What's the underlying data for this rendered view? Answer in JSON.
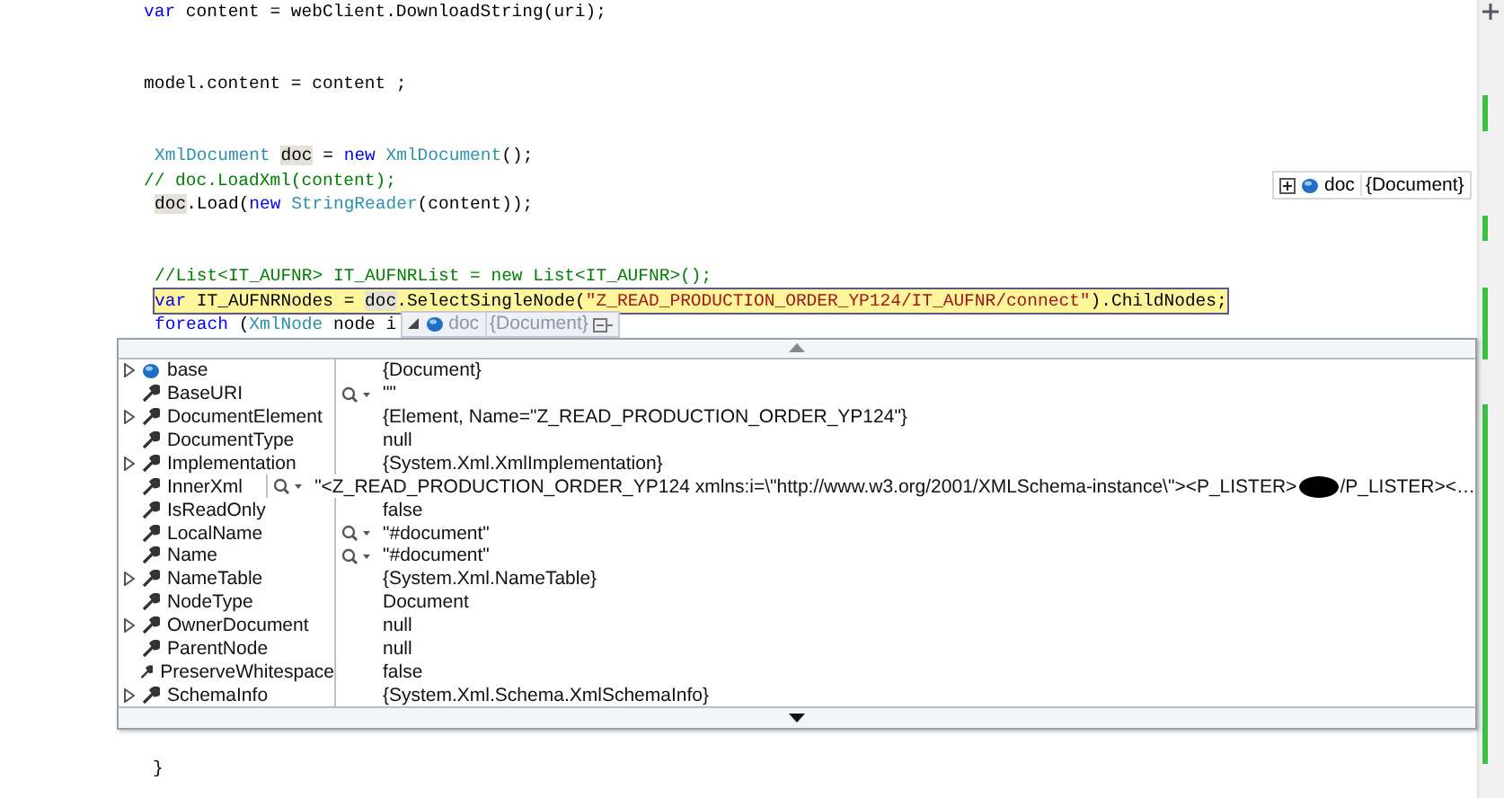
{
  "code_blocks": [
    {
      "lines": [
        {
          "kind": "flush",
          "current": false,
          "tokens": [
            {
              "kind": "keyword",
              "text": "var"
            },
            {
              "kind": "plain",
              "text": " content = webClient.DownloadString(uri);"
            }
          ]
        }
      ]
    },
    {
      "lines": [
        {
          "kind": "flush",
          "current": false,
          "tokens": [
            {
              "kind": "plain",
              "text": "model.content = content ;"
            }
          ]
        }
      ]
    },
    {
      "lines": [
        {
          "kind": "indented",
          "current": false,
          "tokens": [
            {
              "kind": "type",
              "text": "XmlDocument "
            },
            {
              "kind": "reference",
              "text": "doc"
            },
            {
              "kind": "plain",
              "text": " = "
            },
            {
              "kind": "keyword",
              "text": "new "
            },
            {
              "kind": "type",
              "text": "XmlDocument"
            },
            {
              "kind": "plain",
              "text": "();"
            }
          ]
        },
        {
          "kind": "flush",
          "current": false,
          "tokens": [
            {
              "kind": "comment",
              "text": "// doc.LoadXml(content);"
            }
          ]
        },
        {
          "kind": "indented",
          "current": false,
          "tokens": [
            {
              "kind": "reference",
              "text": "doc"
            },
            {
              "kind": "plain",
              "text": ".Load("
            },
            {
              "kind": "keyword",
              "text": "new "
            },
            {
              "kind": "type",
              "text": "StringReader"
            },
            {
              "kind": "plain",
              "text": "(content));"
            }
          ]
        }
      ]
    },
    {
      "lines": [
        {
          "kind": "indented",
          "current": false,
          "tokens": [
            {
              "kind": "comment",
              "text": "//List<IT_AUFNR> IT_AUFNRList = new List<IT_AUFNR>();"
            }
          ]
        },
        {
          "kind": "indented",
          "current": true,
          "tokens": [
            {
              "kind": "keyword",
              "text": "var"
            },
            {
              "kind": "plain",
              "text": " IT_AUFNRNodes = "
            },
            {
              "kind": "reference",
              "text": "doc"
            },
            {
              "kind": "plain",
              "text": ".SelectSingleNode("
            },
            {
              "kind": "string",
              "text": "\"Z_READ_PRODUCTION_ORDER_YP124/IT_AUFNR/connect\""
            },
            {
              "kind": "plain",
              "text": ").ChildNodes;"
            }
          ]
        },
        {
          "kind": "indented",
          "current": false,
          "tokens": [
            {
              "kind": "keyword",
              "text": "foreach"
            },
            {
              "kind": "plain",
              "text": " ("
            },
            {
              "kind": "type",
              "text": "XmlNode"
            },
            {
              "kind": "plain",
              "text": " node i"
            }
          ],
          "datatip": {
            "name": "doc",
            "value": "{Document}"
          }
        }
      ]
    }
  ],
  "pinned_datatip": {
    "name": "doc",
    "value": "{Document}"
  },
  "datatip_list": {
    "rows": [
      {
        "name": "base",
        "kind": "field",
        "expandable": true,
        "visualizer": false,
        "value": "{Document}"
      },
      {
        "name": "BaseURI",
        "kind": "property",
        "expandable": false,
        "visualizer": true,
        "value": "\"\""
      },
      {
        "name": "DocumentElement",
        "kind": "property",
        "expandable": true,
        "visualizer": false,
        "value": "{Element, Name=\"Z_READ_PRODUCTION_ORDER_YP124\"}"
      },
      {
        "name": "DocumentType",
        "kind": "property",
        "expandable": false,
        "visualizer": false,
        "value": "null"
      },
      {
        "name": "Implementation",
        "kind": "property",
        "expandable": true,
        "visualizer": false,
        "value": "{System.Xml.XmlImplementation}"
      },
      {
        "name": "InnerXml",
        "kind": "property",
        "expandable": false,
        "visualizer": true,
        "value": "\"<Z_READ_PRODUCTION_ORDER_YP124 xmlns:i=\\\"http://www.w3.org/2001/XMLSchema-instance\\\"><P_LISTER>",
        "redacted": true,
        "value_after": "/P_LISTER><…"
      },
      {
        "name": "IsReadOnly",
        "kind": "property",
        "expandable": false,
        "visualizer": false,
        "value": "false"
      },
      {
        "name": "LocalName",
        "kind": "property",
        "expandable": false,
        "visualizer": true,
        "value": "\"#document\""
      },
      {
        "name": "Name",
        "kind": "property",
        "expandable": false,
        "visualizer": true,
        "value": "\"#document\""
      },
      {
        "name": "NameTable",
        "kind": "property",
        "expandable": true,
        "visualizer": false,
        "value": "{System.Xml.NameTable}"
      },
      {
        "name": "NodeType",
        "kind": "property",
        "expandable": false,
        "visualizer": false,
        "value": "Document"
      },
      {
        "name": "OwnerDocument",
        "kind": "property",
        "expandable": true,
        "visualizer": false,
        "value": "null"
      },
      {
        "name": "ParentNode",
        "kind": "property",
        "expandable": false,
        "visualizer": false,
        "value": "null"
      },
      {
        "name": "PreserveWhitespace",
        "kind": "property",
        "expandable": false,
        "visualizer": false,
        "value": "false"
      },
      {
        "name": "SchemaInfo",
        "kind": "property",
        "expandable": true,
        "visualizer": false,
        "value": "{System.Xml.Schema.XmlSchemaInfo}"
      }
    ]
  },
  "closing_line": {
    "text": "}"
  }
}
